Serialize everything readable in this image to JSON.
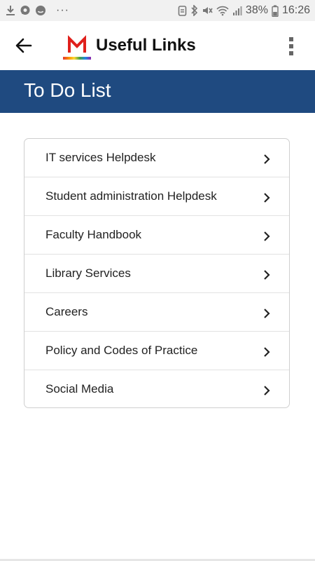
{
  "status_bar": {
    "battery": "38%",
    "time": "16:26",
    "overflow": "···",
    "icons": [
      "download-icon",
      "chat-bubble-icon",
      "face-icon",
      "bluetooth-icon",
      "mute-icon",
      "wifi-icon",
      "signal-icon",
      "battery-icon"
    ]
  },
  "app_bar": {
    "title": "Useful Links",
    "logo_letter": "M",
    "back_icon": "arrow-left-icon",
    "menu_icon": "more-vertical-icon"
  },
  "header": {
    "title": "To Do List",
    "color": "#1f4a80"
  },
  "links": [
    {
      "label": "IT services Helpdesk"
    },
    {
      "label": "Student administration Helpdesk"
    },
    {
      "label": "Faculty Handbook"
    },
    {
      "label": "Library Services"
    },
    {
      "label": "Careers"
    },
    {
      "label": "Policy and Codes of Practice"
    },
    {
      "label": "Social Media"
    }
  ],
  "colors": {
    "logo_red": "#e0201c",
    "header_blue": "#1f4a80"
  }
}
